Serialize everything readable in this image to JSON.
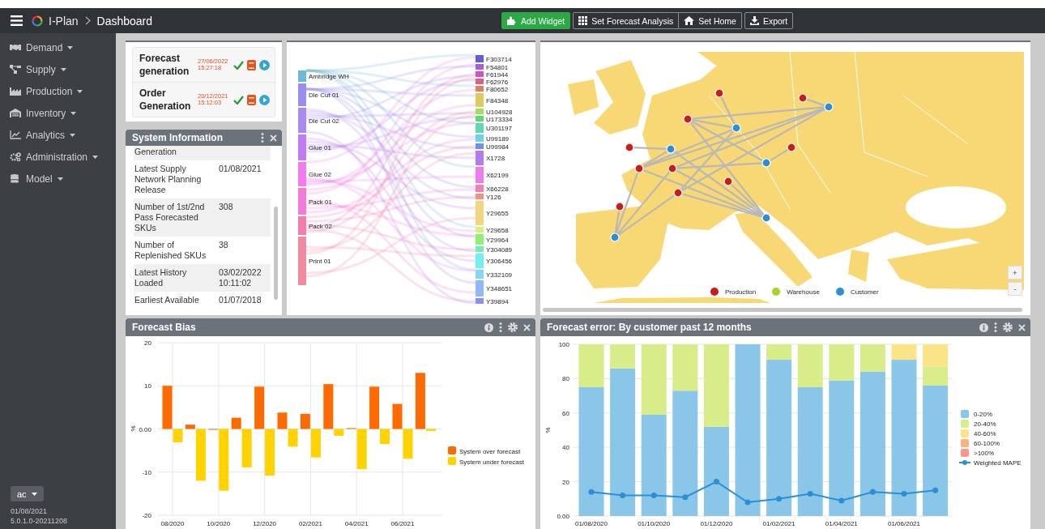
{
  "header": {
    "title": "I-Plan",
    "page": "Dashboard",
    "buttons": [
      {
        "label": "Add Widget",
        "kind": "add"
      },
      {
        "label": "Set Forecast Analysis",
        "kind": "grid"
      },
      {
        "label": "Set Home",
        "kind": "home"
      },
      {
        "label": "Export",
        "kind": "export"
      }
    ]
  },
  "sidebar": {
    "items": [
      {
        "label": "Demand",
        "kind": "handshake"
      },
      {
        "label": "Supply",
        "kind": "network"
      },
      {
        "label": "Production",
        "kind": "factory"
      },
      {
        "label": "Inventory",
        "kind": "warehouse"
      },
      {
        "label": "Analytics",
        "kind": "chart"
      },
      {
        "label": "Administration",
        "kind": "gears"
      },
      {
        "label": "Model",
        "kind": "database"
      }
    ],
    "user": "ac",
    "date": "01/08/2021",
    "version": "5.0.1.0-20211208"
  },
  "jobs": [
    {
      "title": "Forecast generation",
      "date": "27/06/2022",
      "time": "15:27:18"
    },
    {
      "title": "Order Generation",
      "date": "20/12/2021",
      "time": "15:12:03"
    }
  ],
  "system_information": {
    "title": "System Information",
    "rows": [
      {
        "label": "Generation"
      },
      {
        "label": "Latest Supply Network Planning Release",
        "value": "01/08/2021"
      },
      {
        "label": "Number of 1st/2nd Pass Forecasted SKUs",
        "value": "308"
      },
      {
        "label": "Number of Replenished SKUs",
        "value": "38"
      },
      {
        "label": "Latest History Loaded",
        "value": "03/02/2022 10:11:02"
      },
      {
        "label": "Earliest Available",
        "value": "01/07/2018"
      }
    ]
  },
  "sankey": {
    "sources": [
      {
        "label": "Ambridge WH",
        "color": "#6bb8d8"
      },
      {
        "label": "Die Cut 01",
        "color": "#9b8cf0"
      },
      {
        "label": "Die Cut 02",
        "color": "#a98af0"
      },
      {
        "label": "Glue 01",
        "color": "#c07cf0"
      },
      {
        "label": "Glue 02",
        "color": "#f07cf0"
      },
      {
        "label": "Pack 01",
        "color": "#f07cd8"
      },
      {
        "label": "Pack 02",
        "color": "#f07cb0"
      },
      {
        "label": "Print 01",
        "color": "#f08aa0"
      }
    ],
    "targets": [
      {
        "label": "F303714",
        "color": "#6060d8"
      },
      {
        "label": "F54801",
        "color": "#a060e0"
      },
      {
        "label": "F61944",
        "color": "#d050d0"
      },
      {
        "label": "F62976",
        "color": "#e06080"
      },
      {
        "label": "F80652",
        "color": "#e08060"
      },
      {
        "label": "F84348",
        "color": "#dccc60"
      },
      {
        "label": "U104928",
        "color": "#a0e060"
      },
      {
        "label": "U173334",
        "color": "#60d870"
      },
      {
        "label": "U301197",
        "color": "#60d8b0"
      },
      {
        "label": "U99189",
        "color": "#70d0f0"
      },
      {
        "label": "U99984",
        "color": "#7090f0"
      },
      {
        "label": "X1728",
        "color": "#b07cf0"
      },
      {
        "label": "X62199",
        "color": "#f07cf0"
      },
      {
        "label": "X66228",
        "color": "#f080b0"
      },
      {
        "label": "Y126",
        "color": "#f09080"
      },
      {
        "label": "Y29655",
        "color": "#f5d480"
      },
      {
        "label": "Y29658",
        "color": "#d8f080"
      },
      {
        "label": "Y29964",
        "color": "#90f070"
      },
      {
        "label": "Y304089",
        "color": "#70f0b0"
      },
      {
        "label": "Y306456",
        "color": "#70f0f0"
      },
      {
        "label": "Y332109",
        "color": "#80d8f8"
      },
      {
        "label": "Y348651",
        "color": "#90b8f8"
      },
      {
        "label": "Y39894",
        "color": "#8890f8"
      }
    ]
  },
  "map": {
    "legend": [
      {
        "label": "Production",
        "color": "#cc1b1b"
      },
      {
        "label": "Warehouse",
        "color": "#a6d22a"
      },
      {
        "label": "Customer",
        "color": "#2b8fd6"
      }
    ],
    "zoom_buttons": [
      "+",
      "-"
    ]
  },
  "forecast_bias": {
    "title": "Forecast Bias",
    "chart_data": {
      "type": "bar",
      "ylabel": "%",
      "categories": [
        "08/2020",
        null,
        "10/2020",
        null,
        "12/2020",
        null,
        "02/2021",
        null,
        "04/2021",
        null,
        "06/2021",
        null
      ],
      "grid": true,
      "legend": "right",
      "ylim": [
        -20,
        20
      ],
      "yticks": [
        -20,
        -10,
        {
          "value": 0,
          "label": "0.00"
        },
        10,
        20
      ],
      "series": [
        {
          "name": "System over forecast",
          "color": "#ff6a00",
          "values": [
            10,
            1,
            -0.2,
            2.6,
            9.8,
            3.8,
            3.5,
            10.4,
            0.2,
            9.8,
            5.8,
            13
          ]
        },
        {
          "name": "System under forecast",
          "color": "#ffd200",
          "values": [
            -3.1,
            -12,
            -14.3,
            -8.9,
            -10.8,
            -4.1,
            -6.6,
            -1.6,
            -9.3,
            -3.5,
            -6.9,
            -0.5
          ]
        }
      ]
    }
  },
  "forecast_error": {
    "title": "Forecast error: By customer past 12 months",
    "chart_data": {
      "type": "bar",
      "stacked": true,
      "ylabel": "%",
      "categories": [
        "01/08/2020",
        null,
        "01/10/2020",
        null,
        "01/12/2020",
        null,
        "01/02/2021",
        null,
        "01/04/2021",
        null,
        "01/06/2021",
        null
      ],
      "grid": true,
      "legend": "right",
      "ylim": [
        0,
        100
      ],
      "yticks": [
        {
          "value": 0,
          "label": "0.00"
        },
        20,
        40,
        60,
        80,
        100
      ],
      "series": [
        {
          "name": "0-20%",
          "color": "#8ac6e8",
          "values": [
            75,
            86,
            59,
            73,
            52,
            100,
            91,
            75,
            79,
            84,
            91,
            76
          ]
        },
        {
          "name": "20-40%",
          "color": "#d8ec8a",
          "values": [
            25,
            14,
            41,
            27,
            48,
            0,
            9,
            25,
            21,
            16,
            0,
            11
          ]
        },
        {
          "name": "40-60%",
          "color": "#fbe487",
          "values": [
            0,
            0,
            0,
            0,
            0,
            0,
            0,
            0,
            0,
            0,
            9,
            13
          ]
        },
        {
          "name": "60-100%",
          "color": "#fbb47c",
          "values": [
            0,
            0,
            0,
            0,
            0,
            0,
            0,
            0,
            0,
            0,
            0,
            0
          ]
        },
        {
          "name": ">100%",
          "color": "#f79a8a",
          "values": [
            0,
            0,
            0,
            0,
            0,
            0,
            0,
            0,
            0,
            0,
            0,
            0
          ]
        },
        {
          "name": "Weighted MAPE",
          "type": "line",
          "marker": "circle",
          "color": "#2a8fd4",
          "values": [
            14,
            12,
            12,
            11,
            20,
            8,
            10,
            13,
            9,
            14,
            13,
            15
          ]
        }
      ]
    }
  }
}
